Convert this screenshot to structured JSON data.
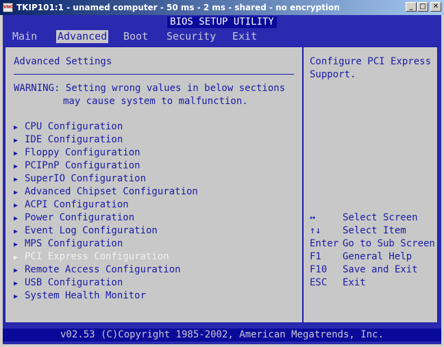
{
  "window": {
    "title": "TKIP101:1 - unamed computer - 50 ms - 2 ms - shared - no encryption",
    "icon_label": "VNC",
    "minimize": "_",
    "maximize": "□",
    "close": "✕"
  },
  "bios": {
    "utility_title": "BIOS SETUP UTILITY",
    "tabs": [
      {
        "label": "Main"
      },
      {
        "label": "Advanced"
      },
      {
        "label": "Boot"
      },
      {
        "label": "Security"
      },
      {
        "label": "Exit"
      }
    ],
    "active_tab": "Advanced",
    "heading": "Advanced Settings",
    "warning_line1": "WARNING: Setting wrong values in below sections",
    "warning_line2": "may cause system to malfunction.",
    "arrow_glyph": "▶",
    "menu_items": [
      {
        "label": "CPU Configuration"
      },
      {
        "label": "IDE Configuration"
      },
      {
        "label": "Floppy Configuration"
      },
      {
        "label": "PCIPnP Configuration"
      },
      {
        "label": "SuperIO Configuration"
      },
      {
        "label": "Advanced Chipset Configuration"
      },
      {
        "label": "ACPI Configuration"
      },
      {
        "label": "Power Configuration"
      },
      {
        "label": "Event Log Configuration"
      },
      {
        "label": "MPS Configuration"
      },
      {
        "label": "PCI Express Configuration",
        "highlighted": true
      },
      {
        "label": "Remote Access Configuration"
      },
      {
        "label": "USB Configuration"
      },
      {
        "label": "System Health Monitor"
      }
    ],
    "help_text": "Configure PCI Express Support.",
    "keys": [
      {
        "key": "↔",
        "desc": "Select Screen"
      },
      {
        "key": "↑↓",
        "desc": "Select Item"
      },
      {
        "key": "Enter",
        "desc": "Go to Sub Screen"
      },
      {
        "key": "F1",
        "desc": "General Help"
      },
      {
        "key": "F10",
        "desc": "Save and Exit"
      },
      {
        "key": "ESC",
        "desc": "Exit"
      }
    ],
    "footer": "v02.53 (C)Copyright 1985-2002, American Megatrends, Inc.",
    "colors": {
      "screen_bg": "#2a2ab0",
      "panel_bg": "#c8c8c8",
      "text_blue": "#1a1aa6",
      "highlight_text": "#f0f0f0"
    }
  }
}
